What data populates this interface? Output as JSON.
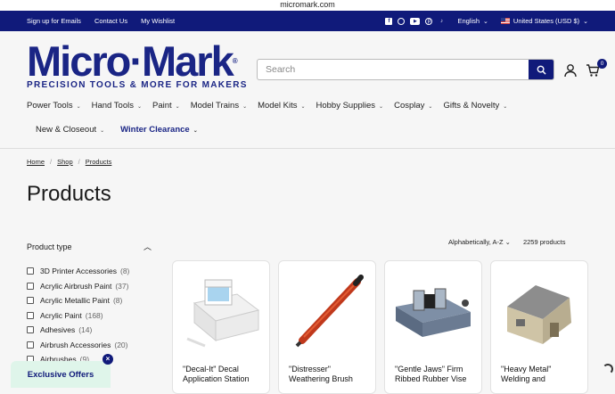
{
  "browser": {
    "url": "micromark.com"
  },
  "topbar": {
    "links": [
      "Sign up for Emails",
      "Contact Us",
      "My Wishlist"
    ],
    "social_icons": [
      "facebook-icon",
      "instagram-icon",
      "youtube-icon",
      "pinterest-icon",
      "tiktok-icon"
    ],
    "language": "English",
    "country": "United States (USD $)"
  },
  "logo": {
    "name": "Micro·Mark",
    "reg": "®",
    "tagline": "PRECISION TOOLS & MORE FOR MAKERS"
  },
  "search": {
    "placeholder": "Search"
  },
  "cart": {
    "count": "0"
  },
  "nav": {
    "row1": [
      "Power Tools",
      "Hand Tools",
      "Paint",
      "Model Trains",
      "Model Kits",
      "Hobby Supplies",
      "Cosplay",
      "Gifts & Novelty"
    ],
    "row2": [
      "New & Closeout",
      "Winter Clearance"
    ]
  },
  "breadcrumb": [
    "Home",
    "Shop",
    "Products"
  ],
  "page_title": "Products",
  "filter": {
    "heading": "Product type",
    "items": [
      {
        "label": "3D Printer Accessories",
        "count": "(8)"
      },
      {
        "label": "Acrylic Airbrush Paint",
        "count": "(37)"
      },
      {
        "label": "Acrylic Metallic Paint",
        "count": "(8)"
      },
      {
        "label": "Acrylic Paint",
        "count": "(168)"
      },
      {
        "label": "Adhesives",
        "count": "(14)"
      },
      {
        "label": "Airbrush Accessories",
        "count": "(20)"
      },
      {
        "label": "Airbrushes",
        "count": "(9)"
      }
    ]
  },
  "sort": {
    "label": "Alphabetically, A-Z",
    "count": "2259 products"
  },
  "products": [
    {
      "title": "\"Decal-It\" Decal Application Station"
    },
    {
      "title": "\"Distresser\" Weathering Brush"
    },
    {
      "title": "\"Gentle Jaws\" Firm Ribbed Rubber Vise"
    },
    {
      "title": "\"Heavy Metal\" Welding and"
    }
  ],
  "popup": {
    "label": "Exclusive Offers",
    "close": "×"
  },
  "colors": {
    "brand": "#101a7a",
    "accent": "#1a2585"
  }
}
